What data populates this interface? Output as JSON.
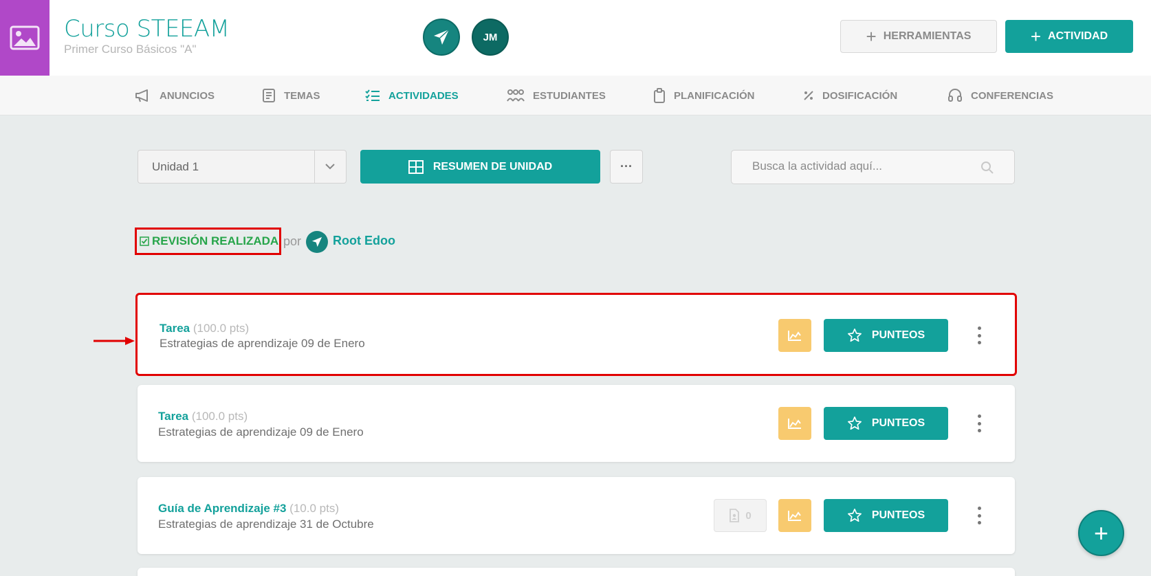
{
  "header": {
    "course_title": "Curso STEEAM",
    "course_subtitle": "Primer Curso Básicos \"A\"",
    "avatar_initials": "JM",
    "tools_label": "HERRAMIENTAS",
    "activity_label": "ACTIVIDAD"
  },
  "nav": {
    "items": [
      {
        "label": "ANUNCIOS",
        "icon": "megaphone-icon"
      },
      {
        "label": "TEMAS",
        "icon": "book-icon"
      },
      {
        "label": "ACTIVIDADES",
        "icon": "checklist-icon",
        "active": true
      },
      {
        "label": "ESTUDIANTES",
        "icon": "students-icon"
      },
      {
        "label": "PLANIFICACIÓN",
        "icon": "clipboard-icon"
      },
      {
        "label": "DOSIFICACIÓN",
        "icon": "percent-icon"
      },
      {
        "label": "CONFERENCIAS",
        "icon": "headset-icon"
      }
    ]
  },
  "toolbar": {
    "unit_value": "Unidad 1",
    "summary_label": "RESUMEN DE UNIDAD",
    "more_label": "···",
    "search_placeholder": "Busca la actividad aquí..."
  },
  "revision": {
    "label": "REVISIÓN REALIZADA",
    "by_text": "por",
    "reviewer": "Root Edoo"
  },
  "activities": [
    {
      "title": "Tarea",
      "points": "(100.0 pts)",
      "description": "Estrategias de aprendizaje 09 de Enero",
      "action_label": "PUNTEOS"
    },
    {
      "title": "Tarea",
      "points": "(100.0 pts)",
      "description": "Estrategias de aprendizaje 09 de Enero",
      "action_label": "PUNTEOS"
    },
    {
      "title": "Guía de Aprendizaje #3",
      "points": "(10.0 pts)",
      "description": "Estrategias de aprendizaje 31 de Octubre",
      "action_label": "PUNTEOS",
      "submissions": "0"
    }
  ],
  "fab_label": "+",
  "colors": {
    "accent": "#13a19b",
    "course_image": "#b048c8",
    "stats_button": "#f8ca6f",
    "revision_green": "#27a54a",
    "highlight_red": "#e10000"
  }
}
